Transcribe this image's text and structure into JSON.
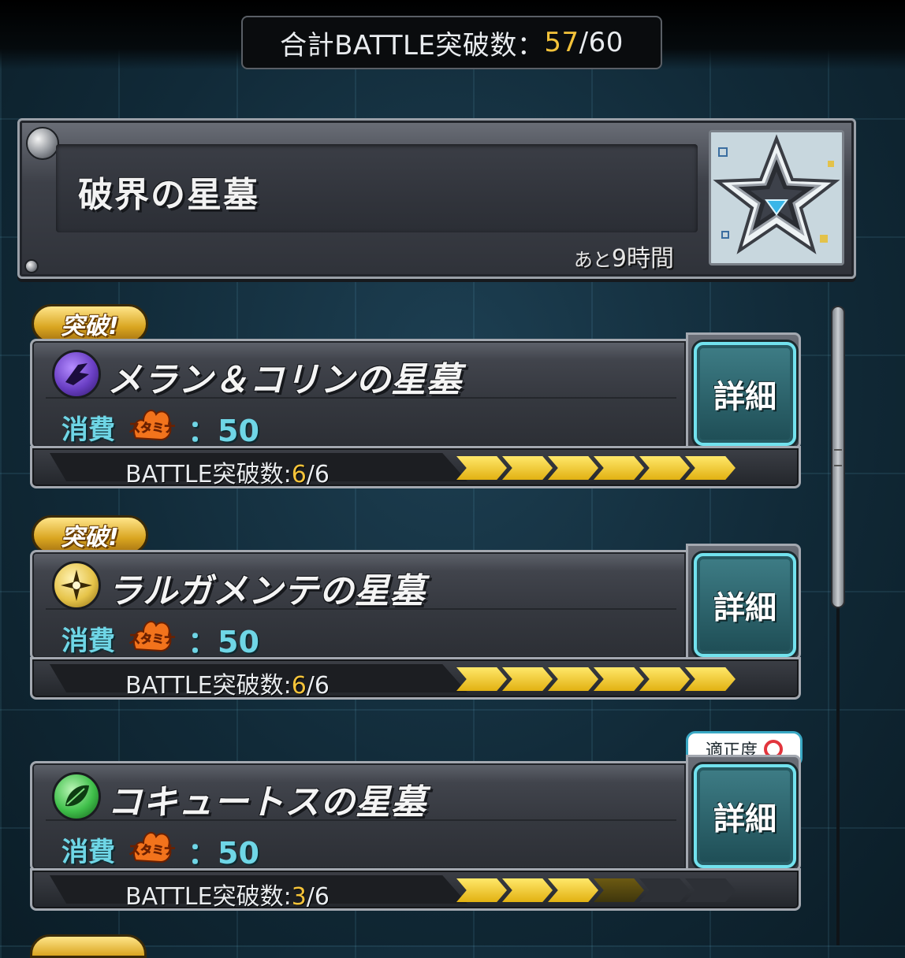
{
  "summary": {
    "label": "合計BATTLE突破数：",
    "current": "57",
    "separator": "/",
    "total": "60"
  },
  "header": {
    "title": "破界の星墓",
    "time_prefix": "あと",
    "time_value": "9時間"
  },
  "quests": [
    {
      "badge": "突破!",
      "name": "メラン＆コリンの星墓",
      "element_icon": "dark-element-icon",
      "cost_label": "消費",
      "stamina_label": "スタミナ",
      "cost_value": "：50",
      "detail_label": "詳細",
      "progress_label": "BATTLE突破数:",
      "progress_current": "6",
      "progress_total": "/6",
      "progress_fraction": 1.0
    },
    {
      "badge": "突破!",
      "name": "ラルガメンテの星墓",
      "element_icon": "light-element-icon",
      "cost_label": "消費",
      "stamina_label": "スタミナ",
      "cost_value": "：50",
      "detail_label": "詳細",
      "progress_label": "BATTLE突破数:",
      "progress_current": "6",
      "progress_total": "/6",
      "progress_fraction": 1.0
    },
    {
      "badge": "",
      "aptitude_label": "適正度",
      "aptitude_icon": "circle-mark-icon",
      "name": "コキュートスの星墓",
      "element_icon": "wood-element-icon",
      "cost_label": "消費",
      "stamina_label": "スタミナ",
      "cost_value": "：50",
      "detail_label": "詳細",
      "progress_label": "BATTLE突破数:",
      "progress_current": "3",
      "progress_total": "/6",
      "progress_fraction": 0.5
    }
  ],
  "colors": {
    "accent_yellow": "#f4c33a",
    "cyan": "#6fd6e6",
    "dark_element": "#6a3fc4",
    "light_element": "#e6c44a",
    "wood_element": "#3fbf4a"
  }
}
